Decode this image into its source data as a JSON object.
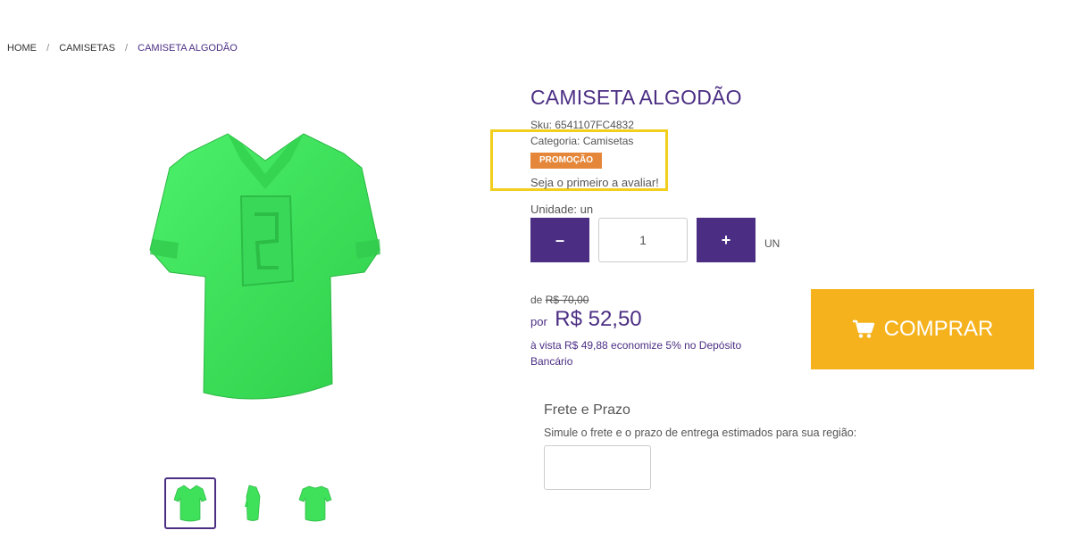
{
  "breadcrumb": {
    "items": [
      "HOME",
      "CAMISETAS",
      "CAMISETA ALGODÃO"
    ],
    "separator": "/"
  },
  "product": {
    "title": "CAMISETA ALGODÃO",
    "sku": "Sku: 6541107FC4832",
    "category": "Categoria: Camisetas",
    "badge": "PROMOÇÃO",
    "review_prompt": "Seja o primeiro a avaliar!",
    "image_color": "#3fe05a"
  },
  "quantity": {
    "unit_label": "Unidade: un",
    "minus_label": "–",
    "plus_label": "+",
    "value": "1",
    "suffix": "UN"
  },
  "pricing": {
    "old_prefix": "de",
    "old_price": "R$ 70,00",
    "new_prefix": "por",
    "new_price": "R$ 52,50",
    "cash_note": "à vista R$ 49,88 economize 5% no Depósito Bancário"
  },
  "buy": {
    "label": "COMPRAR",
    "icon": "cart-icon",
    "color": "#f5b21c"
  },
  "shipping": {
    "title": "Frete e Prazo",
    "description": "Simule o frete e o prazo de entrega estimados para sua região:",
    "zip_value": ""
  },
  "colors": {
    "brand": "#4b2e83",
    "promo": "#e5873a",
    "highlight": "#f2cf1f"
  }
}
